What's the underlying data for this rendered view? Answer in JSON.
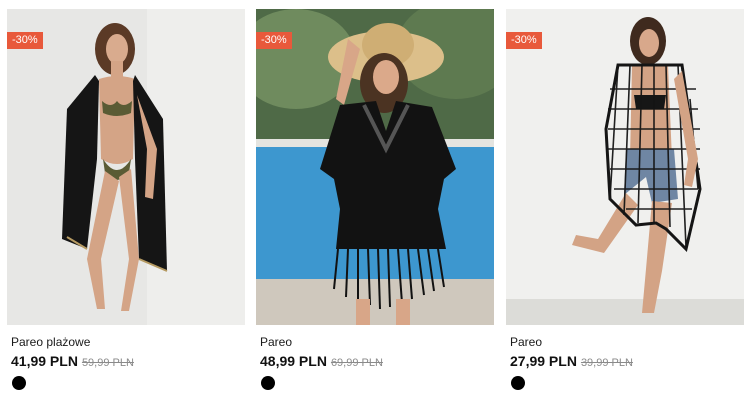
{
  "products": [
    {
      "discount": "-30%",
      "name": "Pareo plażowe",
      "price": "41,99 PLN",
      "old_price": "59,99 PLN",
      "color": "#000000"
    },
    {
      "discount": "-30%",
      "name": "Pareo",
      "price": "48,99 PLN",
      "old_price": "69,99 PLN",
      "color": "#000000"
    },
    {
      "discount": "-30%",
      "name": "Pareo",
      "price": "27,99 PLN",
      "old_price": "39,99 PLN",
      "color": "#000000"
    }
  ],
  "colors": {
    "badge": "#e8593b",
    "price": "#111111",
    "old_price": "#8a8a8a"
  }
}
